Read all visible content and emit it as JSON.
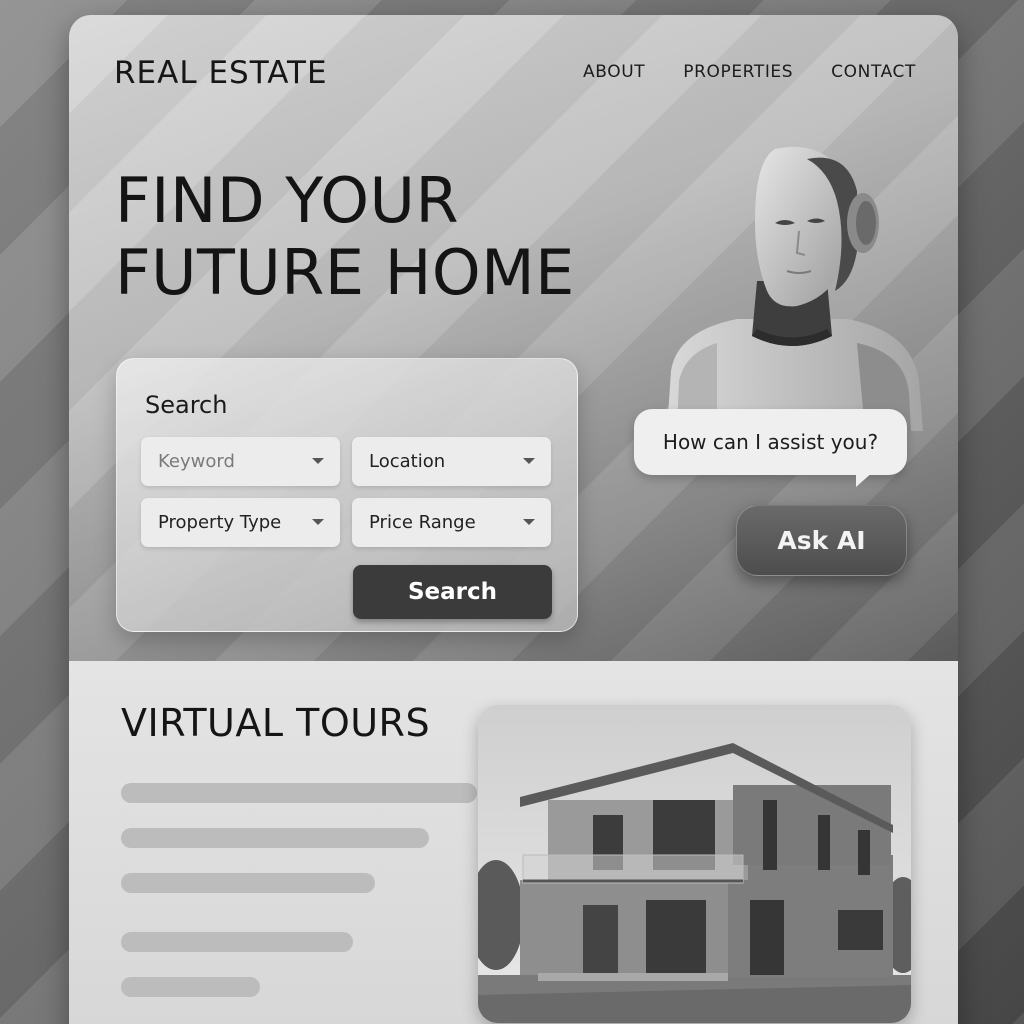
{
  "header": {
    "brand": "REAL ESTATE",
    "nav": [
      "ABOUT",
      "PROPERTIES",
      "CONTACT"
    ]
  },
  "hero": {
    "headline_line1": "FIND YOUR",
    "headline_line2": "FUTURE HOME"
  },
  "search": {
    "title": "Search",
    "keyword_placeholder": "Keyword",
    "location": "Location",
    "property_type": "Property Type",
    "price_range": "Price Range",
    "button": "Search"
  },
  "assistant": {
    "bubble": "How can I assist you?",
    "button": "Ask AI"
  },
  "tours": {
    "title": "VIRTUAL TOURS"
  },
  "icons": {
    "dropdown": "chevron-down-icon"
  }
}
